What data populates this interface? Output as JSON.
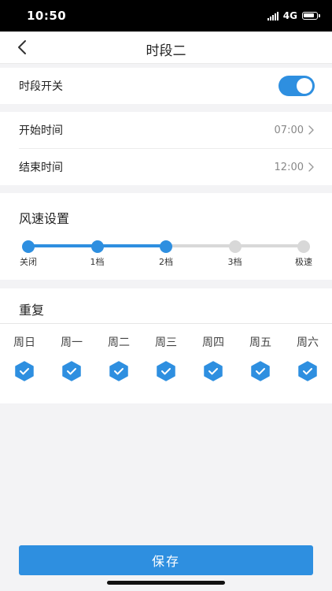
{
  "status_bar": {
    "time": "10:50",
    "network": "4G"
  },
  "header": {
    "title": "时段二"
  },
  "period_switch": {
    "label": "时段开关",
    "enabled": true
  },
  "time_settings": {
    "start": {
      "label": "开始时间",
      "value": "07:00"
    },
    "end": {
      "label": "结束时间",
      "value": "12:00"
    }
  },
  "wind_speed": {
    "title": "风速设置",
    "levels": [
      "关闭",
      "1档",
      "2档",
      "3档",
      "极速"
    ],
    "selected_index": 2
  },
  "repeat": {
    "title": "重复",
    "days": [
      {
        "label": "周日",
        "checked": true
      },
      {
        "label": "周一",
        "checked": true
      },
      {
        "label": "周二",
        "checked": true
      },
      {
        "label": "周三",
        "checked": true
      },
      {
        "label": "周四",
        "checked": true
      },
      {
        "label": "周五",
        "checked": true
      },
      {
        "label": "周六",
        "checked": true
      }
    ]
  },
  "footer": {
    "save_label": "保存"
  },
  "colors": {
    "accent": "#2e8fe0",
    "inactive": "#d8d8d8",
    "page_bg": "#f3f3f5"
  }
}
